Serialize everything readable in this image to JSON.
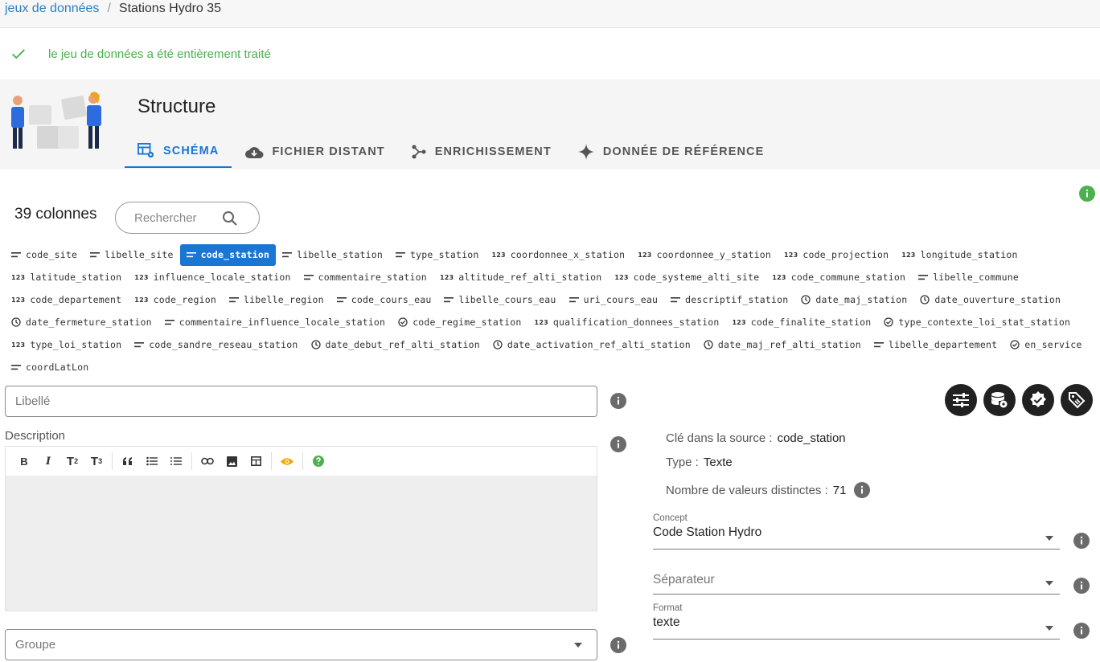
{
  "breadcrumb": {
    "root": "jeux de données",
    "separator": "/",
    "current": "Stations Hydro 35"
  },
  "alert": {
    "message": "le jeu de données a été entièrement traité",
    "color": "#4caf50"
  },
  "header": {
    "title": "Structure",
    "tabs": [
      {
        "label": "SCHÉMA",
        "icon": "table-settings-icon",
        "active": true
      },
      {
        "label": "FICHIER DISTANT",
        "icon": "cloud-download-icon",
        "active": false
      },
      {
        "label": "ENRICHISSEMENT",
        "icon": "graph-icon",
        "active": false
      },
      {
        "label": "DONNÉE DE RÉFÉRENCE",
        "icon": "sparkle-icon",
        "active": false
      }
    ]
  },
  "columns": {
    "count_label": "39 colonnes",
    "search_placeholder": "Rechercher",
    "rows": [
      [
        {
          "name": "code_site",
          "type": "text"
        },
        {
          "name": "libelle_site",
          "type": "text"
        },
        {
          "name": "code_station",
          "type": "text",
          "active": true
        },
        {
          "name": "libelle_station",
          "type": "text"
        },
        {
          "name": "type_station",
          "type": "text"
        },
        {
          "name": "coordonnee_x_station",
          "type": "number"
        },
        {
          "name": "coordonnee_y_station",
          "type": "number"
        },
        {
          "name": "code_projection",
          "type": "number"
        },
        {
          "name": "longitude_station",
          "type": "number"
        }
      ],
      [
        {
          "name": "latitude_station",
          "type": "number"
        },
        {
          "name": "influence_locale_station",
          "type": "number"
        },
        {
          "name": "commentaire_station",
          "type": "text"
        },
        {
          "name": "altitude_ref_alti_station",
          "type": "number"
        },
        {
          "name": "code_systeme_alti_site",
          "type": "number"
        },
        {
          "name": "code_commune_station",
          "type": "number"
        },
        {
          "name": "libelle_commune",
          "type": "text"
        }
      ],
      [
        {
          "name": "code_departement",
          "type": "number"
        },
        {
          "name": "code_region",
          "type": "number"
        },
        {
          "name": "libelle_region",
          "type": "text"
        },
        {
          "name": "code_cours_eau",
          "type": "text"
        },
        {
          "name": "libelle_cours_eau",
          "type": "text"
        },
        {
          "name": "uri_cours_eau",
          "type": "text"
        },
        {
          "name": "descriptif_station",
          "type": "text"
        },
        {
          "name": "date_maj_station",
          "type": "date"
        },
        {
          "name": "date_ouverture_station",
          "type": "date"
        }
      ],
      [
        {
          "name": "date_fermeture_station",
          "type": "date"
        },
        {
          "name": "commentaire_influence_locale_station",
          "type": "text"
        },
        {
          "name": "code_regime_station",
          "type": "bool"
        },
        {
          "name": "qualification_donnees_station",
          "type": "number"
        },
        {
          "name": "code_finalite_station",
          "type": "number"
        },
        {
          "name": "type_contexte_loi_stat_station",
          "type": "bool"
        }
      ],
      [
        {
          "name": "type_loi_station",
          "type": "number"
        },
        {
          "name": "code_sandre_reseau_station",
          "type": "text"
        },
        {
          "name": "date_debut_ref_alti_station",
          "type": "date"
        },
        {
          "name": "date_activation_ref_alti_station",
          "type": "date"
        },
        {
          "name": "date_maj_ref_alti_station",
          "type": "date"
        },
        {
          "name": "libelle_departement",
          "type": "text"
        },
        {
          "name": "en_service",
          "type": "bool"
        }
      ],
      [
        {
          "name": "coordLatLon",
          "type": "text"
        }
      ]
    ]
  },
  "form": {
    "libelle_placeholder": "Libellé",
    "description_label": "Description",
    "groupe_placeholder": "Groupe"
  },
  "toolbar": {
    "bold": "B",
    "italic": "I",
    "t2": "T",
    "t2_sub": "2",
    "t3": "T",
    "t3_sub": "3"
  },
  "details": {
    "source_key_label": "Clé dans la source :",
    "source_key_value": "code_station",
    "type_label": "Type :",
    "type_value": "Texte",
    "distinct_label": "Nombre de valeurs distinctes :",
    "distinct_value": "71",
    "concept_label": "Concept",
    "concept_value": "Code Station Hydro",
    "separator_placeholder": "Séparateur",
    "format_label": "Format",
    "format_value": "texte"
  },
  "colors": {
    "accent": "#1976d2",
    "link": "#2c7fc3",
    "success": "#4caf50",
    "dark_button": "#212121"
  }
}
